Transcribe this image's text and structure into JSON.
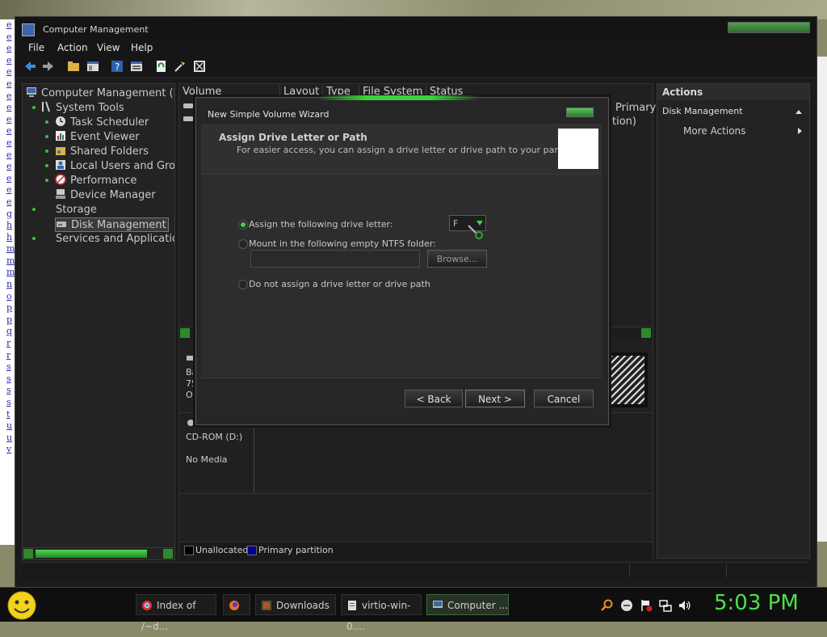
{
  "window": {
    "title": "Computer Management"
  },
  "menu": [
    "File",
    "Action",
    "View",
    "Help"
  ],
  "tree": {
    "root": "Computer Management (Loc",
    "items": [
      {
        "label": "System Tools",
        "level": 1,
        "icon": "tools-icon"
      },
      {
        "label": "Task Scheduler",
        "level": 2,
        "icon": "clock-icon"
      },
      {
        "label": "Event Viewer",
        "level": 2,
        "icon": "event-viewer-icon"
      },
      {
        "label": "Shared Folders",
        "level": 2,
        "icon": "shared-folder-icon"
      },
      {
        "label": "Local Users and Grou",
        "level": 2,
        "icon": "users-icon"
      },
      {
        "label": "Performance",
        "level": 2,
        "icon": "performance-icon"
      },
      {
        "label": "Device Manager",
        "level": 2,
        "icon": "device-manager-icon"
      },
      {
        "label": "Storage",
        "level": 1,
        "icon": "storage-icon"
      },
      {
        "label": "Disk Management",
        "level": 2,
        "icon": "disk-icon"
      },
      {
        "label": "Services and Applications",
        "level": 1,
        "icon": "services-icon"
      }
    ]
  },
  "volume_table": {
    "columns": [
      "Volume",
      "Layout",
      "Type",
      "File System",
      "Status"
    ],
    "partial_right": [
      "Primary",
      "tion)"
    ]
  },
  "disks": {
    "disk0_partial": [
      "Ba",
      "75",
      "O"
    ],
    "cdrom_label": "CD-ROM (D:)",
    "cdrom_media": "No Media"
  },
  "legend": {
    "unallocated": "Unallocated",
    "primary": "Primary partition",
    "colors": {
      "unallocated": "#000000",
      "primary": "#00008b"
    }
  },
  "actions": {
    "header": "Actions",
    "section": "Disk Management",
    "more": "More Actions"
  },
  "dialog": {
    "title": "New Simple Volume Wizard",
    "heading": "Assign Drive Letter or Path",
    "subheading": "For easier access, you can assign a drive letter or drive path to your partition.",
    "option_assign": "Assign the following drive letter:",
    "drive_letter": "F",
    "option_mount": "Mount in the following empty NTFS folder:",
    "browse": "Browse...",
    "option_none": "Do not assign a drive letter or drive path",
    "back": "< Back",
    "next": "Next >",
    "cancel": "Cancel",
    "selected_option": "assign"
  },
  "taskbar": {
    "items": [
      {
        "label": "Index of /~d...",
        "icon": "chrome-icon"
      },
      {
        "label": "",
        "icon": "firefox-icon"
      },
      {
        "label": "Downloads",
        "icon": "downloads-icon"
      },
      {
        "label": "virtio-win-0....",
        "icon": "document-icon"
      },
      {
        "label": "Computer ...",
        "icon": "computer-management-icon"
      }
    ],
    "clock": "5:03 PM"
  },
  "left_links": [
    "e",
    "e",
    "e",
    "e",
    "e",
    "e",
    "e",
    "e",
    "e",
    "e",
    "e",
    "e",
    "e",
    "e",
    "e",
    "e",
    "g",
    "h",
    "h",
    "m",
    "m",
    "m",
    "n",
    "o",
    "p",
    "p",
    "q",
    "r",
    "r",
    "s",
    "s",
    "s",
    "s",
    "t",
    "u",
    "u",
    "v"
  ]
}
